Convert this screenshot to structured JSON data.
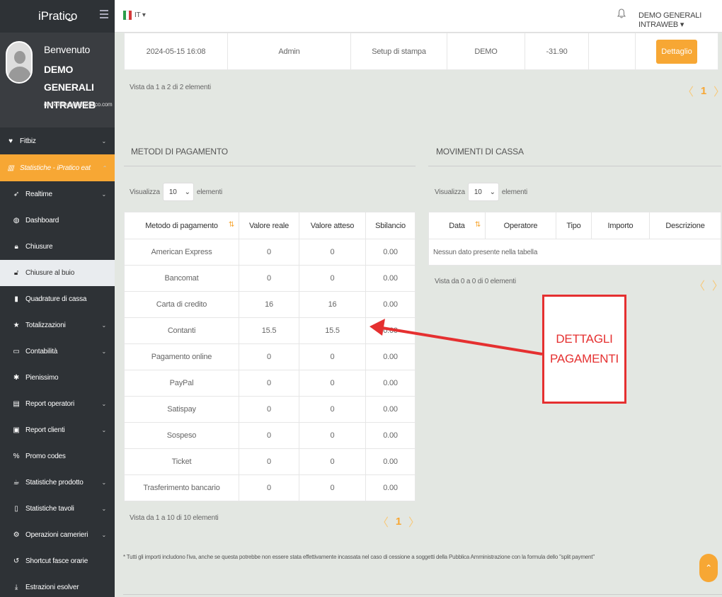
{
  "brand": "iPratico",
  "profile": {
    "welcome": "Benvenuto",
    "name": "DEMO GENERALI INTRAWEB",
    "email": "demointraweb@ipratico.com"
  },
  "menu": [
    {
      "label": "Fitbiz",
      "icon": "heart-icon"
    },
    {
      "label": "Statistiche - iPratico eat",
      "icon": "bar-chart-icon"
    },
    {
      "label": "Realtime",
      "icon": "rocket-icon"
    },
    {
      "label": "Dashboard",
      "icon": "dashboard-icon"
    },
    {
      "label": "Chiusure",
      "icon": "lock-icon"
    },
    {
      "label": "Chiusure al buio",
      "icon": "lock-icon"
    },
    {
      "label": "Quadrature di cassa",
      "icon": "box-icon"
    },
    {
      "label": "Totalizzazioni",
      "icon": "star-icon"
    },
    {
      "label": "Contabilità",
      "icon": "laptop-icon"
    },
    {
      "label": "Pienissimo",
      "icon": "asterisk-icon"
    },
    {
      "label": "Report operatori",
      "icon": "report-icon"
    },
    {
      "label": "Report clienti",
      "icon": "id-card-icon"
    },
    {
      "label": "Promo codes",
      "icon": "percent-icon"
    },
    {
      "label": "Statistiche prodotto",
      "icon": "coffee-icon"
    },
    {
      "label": "Statistiche tavoli",
      "icon": "table-icon"
    },
    {
      "label": "Operazioni camerieri",
      "icon": "gear-icon"
    },
    {
      "label": "Shortcut fasce orarie",
      "icon": "history-icon"
    },
    {
      "label": "Estrazioni esolver",
      "icon": "download-icon"
    }
  ],
  "topbar": {
    "lang": "IT ▾",
    "user": "DEMO GENERALI INTRAWEB ▾"
  },
  "top_table": {
    "row": [
      "2024-05-15 16:08",
      "Admin",
      "Setup di stampa",
      "DEMO",
      "-31.90",
      ""
    ],
    "button": "Dettaglio",
    "info": "Vista da 1 a 2 di 2 elementi",
    "page": "1"
  },
  "payments": {
    "title": "METODI DI PAGAMENTO",
    "show_label": "Visualizza",
    "show_value": "10",
    "show_suffix": "elementi",
    "headers": [
      "Metodo di pagamento",
      "Valore reale",
      "Valore atteso",
      "Sbilancio"
    ],
    "rows": [
      [
        "American Express",
        "0",
        "0",
        "0.00"
      ],
      [
        "Bancomat",
        "0",
        "0",
        "0.00"
      ],
      [
        "Carta di credito",
        "16",
        "16",
        "0.00"
      ],
      [
        "Contanti",
        "15.5",
        "15.5",
        "0.00"
      ],
      [
        "Pagamento online",
        "0",
        "0",
        "0.00"
      ],
      [
        "PayPal",
        "0",
        "0",
        "0.00"
      ],
      [
        "Satispay",
        "0",
        "0",
        "0.00"
      ],
      [
        "Sospeso",
        "0",
        "0",
        "0.00"
      ],
      [
        "Ticket",
        "0",
        "0",
        "0.00"
      ],
      [
        "Trasferimento bancario",
        "0",
        "0",
        "0.00"
      ]
    ],
    "info": "Vista da 1 a 10 di 10 elementi",
    "page": "1"
  },
  "movements": {
    "title": "MOVIMENTI DI CASSA",
    "show_label": "Visualizza",
    "show_value": "10",
    "show_suffix": "elementi",
    "headers": [
      "Data",
      "Operatore",
      "Tipo",
      "Importo",
      "Descrizione"
    ],
    "empty": "Nessun dato presente nella tabella",
    "info": "Vista da 0 a 0 di 0 elementi"
  },
  "footnote": "* Tutti gli importi includono l'iva, anche se questa potrebbe non essere stata effettivamente incassata nel caso di cessione a soggetti della Pubblica Amministrazione con la formula dello \"split payment\"",
  "annotation": {
    "line1": "DETTAGLI",
    "line2": "PAGAMENTI",
    "color": "#e53030"
  },
  "colors": {
    "accent": "#f7a734",
    "sidebar": "#2e3236"
  }
}
